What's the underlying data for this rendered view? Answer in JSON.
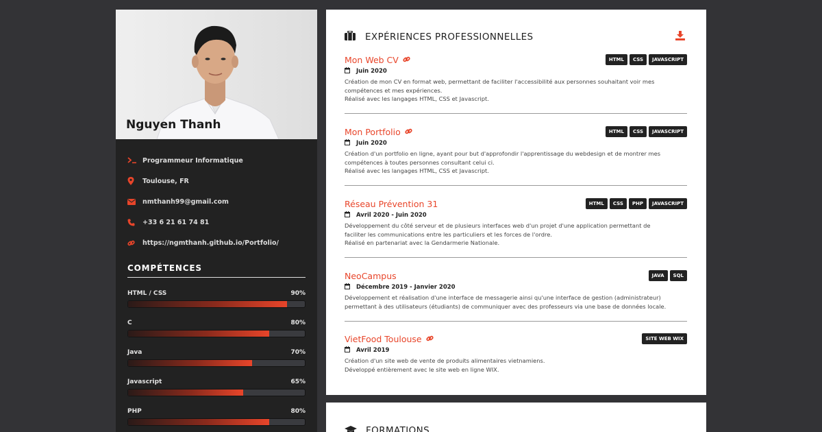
{
  "profile": {
    "name": "Nguyen Thanh",
    "contacts": [
      {
        "icon": "terminal-icon",
        "text": "Programmeur Informatique"
      },
      {
        "icon": "map-marker-icon",
        "text": "Toulouse, FR"
      },
      {
        "icon": "envelope-icon",
        "text": "nmthanh99@gmail.com"
      },
      {
        "icon": "phone-icon",
        "text": "+33 6 21 61 74 81"
      },
      {
        "icon": "link-icon",
        "text": "https://ngmthanh.github.io/Portfolio/"
      }
    ]
  },
  "skills": {
    "title": "COMPÉTENCES",
    "items": [
      {
        "name": "HTML / CSS",
        "percent_label": "90%",
        "level": 90
      },
      {
        "name": "C",
        "percent_label": "80%",
        "level": 80
      },
      {
        "name": "Java",
        "percent_label": "70%",
        "level": 70
      },
      {
        "name": "Javascript",
        "percent_label": "65%",
        "level": 65
      },
      {
        "name": "PHP",
        "percent_label": "80%",
        "level": 80
      }
    ]
  },
  "experiences": {
    "title": "EXPÉRIENCES PROFESSIONNELLES",
    "items": [
      {
        "title": "Mon Web CV",
        "has_link": true,
        "tags": [
          "HTML",
          "CSS",
          "JAVASCRIPT"
        ],
        "date": "Juin 2020",
        "desc": [
          "Création de mon CV en format web, permettant de faciliter l'accessibilité aux personnes souhaitant voir mes",
          "compétences et mes expériences.",
          "Réalisé avec les langages HTML, CSS et Javascript."
        ]
      },
      {
        "title": "Mon Portfolio",
        "has_link": true,
        "tags": [
          "HTML",
          "CSS",
          "JAVASCRIPT"
        ],
        "date": "Juin 2020",
        "desc": [
          "Création d'un portfolio en ligne, ayant pour but d'approfondir l'apprentissage du webdesign et de montrer mes",
          "compétences à toutes personnes consultant celui ci.",
          "Réalisé avec les langages HTML, CSS et Javascript."
        ]
      },
      {
        "title": "Réseau Prévention 31",
        "has_link": false,
        "tags": [
          "HTML",
          "CSS",
          "PHP",
          "JAVASCRIPT"
        ],
        "date": "Avril 2020 - Juin 2020",
        "desc": [
          "Développement du côté serveur et de plusieurs interfaces web d'un projet d'une application permettant de",
          "faciliter les communications entre les particuliers et les forces de l'ordre.",
          "Réalisé en partenariat avec la Gendarmerie Nationale."
        ]
      },
      {
        "title": "NeoCampus",
        "has_link": false,
        "tags": [
          "JAVA",
          "SQL"
        ],
        "date": "Décembre 2019 - Janvier 2020",
        "desc": [
          "Développement et réalisation d'une interface de messagerie ainsi qu'une interface de gestion (administrateur)",
          "permettant à des utilisateurs (étudiants) de communiquer avec des professeurs via une base de données locale."
        ]
      },
      {
        "title": "VietFood Toulouse",
        "has_link": true,
        "tags": [
          "SITE WEB WIX"
        ],
        "date": "Avril 2019",
        "desc": [
          "Création d'un site web de vente de produits alimentaires vietnamiens.",
          "Développé entièrement avec le site web en ligne WIX."
        ]
      }
    ]
  },
  "formations": {
    "title": "FORMATIONS"
  },
  "colors": {
    "accent": "#e8452a",
    "sidebar_bg": "#222222",
    "page_bg": "#333336"
  }
}
